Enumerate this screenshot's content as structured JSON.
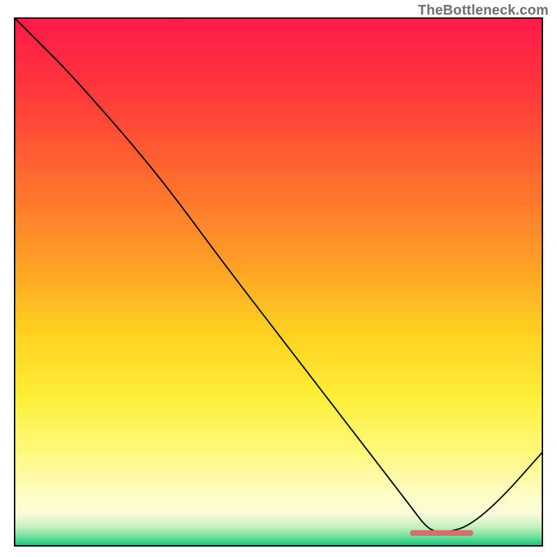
{
  "watermark": "TheBottleneck.com",
  "chart_data": {
    "type": "line",
    "title": "",
    "xlabel": "",
    "ylabel": "",
    "xlim": [
      0,
      100
    ],
    "ylim": [
      0,
      100
    ],
    "background_gradient": {
      "type": "vertical",
      "stops": [
        {
          "pos": 0.0,
          "color": "#ff1a4a"
        },
        {
          "pos": 0.15,
          "color": "#ff3b3b"
        },
        {
          "pos": 0.3,
          "color": "#ff6a2f"
        },
        {
          "pos": 0.45,
          "color": "#ff9a28"
        },
        {
          "pos": 0.6,
          "color": "#ffd220"
        },
        {
          "pos": 0.72,
          "color": "#ffef3a"
        },
        {
          "pos": 0.82,
          "color": "#fff97a"
        },
        {
          "pos": 0.9,
          "color": "#fffcc0"
        },
        {
          "pos": 0.94,
          "color": "#f8fbd8"
        },
        {
          "pos": 0.965,
          "color": "#c9f0c0"
        },
        {
          "pos": 0.985,
          "color": "#6edc9a"
        },
        {
          "pos": 1.0,
          "color": "#17c77c"
        }
      ]
    },
    "series": [
      {
        "name": "bottleneck-curve",
        "color": "#000000",
        "width": 2,
        "x": [
          0.0,
          4.0,
          10.0,
          18.0,
          24.0,
          30.0,
          40.0,
          50.0,
          60.0,
          70.0,
          75.0,
          78.0,
          80.0,
          82.0,
          86.0,
          92.0,
          100.0
        ],
        "y": [
          100.0,
          96.0,
          90.0,
          81.0,
          74.0,
          66.5,
          53.0,
          40.0,
          27.0,
          14.0,
          7.5,
          3.5,
          2.5,
          2.5,
          3.5,
          8.5,
          17.5
        ]
      }
    ],
    "markers": [
      {
        "name": "optimal-zone",
        "shape": "rounded-bar",
        "color": "#d0726c",
        "x_start": 75.0,
        "x_end": 87.0,
        "y": 2.3,
        "thickness_pct": 1.1
      }
    ],
    "grid": false,
    "legend": false
  }
}
